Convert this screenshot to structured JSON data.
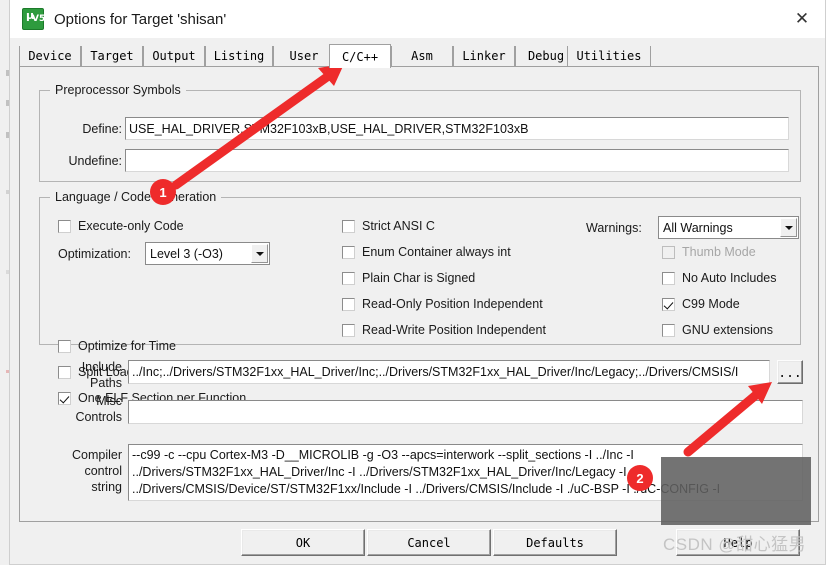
{
  "window": {
    "title": "Options for Target 'shisan'",
    "icon": "keil-uvision5-icon",
    "icon_mu": "µ",
    "icon_v5": "V5",
    "close_label": "✕"
  },
  "tabs": [
    {
      "label": "Device",
      "active": false
    },
    {
      "label": "Target",
      "active": false
    },
    {
      "label": "Output",
      "active": false
    },
    {
      "label": "Listing",
      "active": false
    },
    {
      "label": "User",
      "active": false
    },
    {
      "label": "C/C++",
      "active": true
    },
    {
      "label": "Asm",
      "active": false
    },
    {
      "label": "Linker",
      "active": false
    },
    {
      "label": "Debug",
      "active": false
    },
    {
      "label": "Utilities",
      "active": false
    }
  ],
  "preprocessor": {
    "group_title": "Preprocessor Symbols",
    "define_label": "Define:",
    "define_value": "USE_HAL_DRIVER,STM32F103xB,USE_HAL_DRIVER,STM32F103xB",
    "undefine_label": "Undefine:",
    "undefine_value": ""
  },
  "language": {
    "group_title": "Language / Code Generation",
    "left_options": [
      {
        "label": "Execute-only Code",
        "checked": false,
        "disabled": false
      },
      {
        "label": "Optimize for Time",
        "checked": false,
        "disabled": false
      },
      {
        "label": "Split Load and Store Multiple",
        "checked": false,
        "disabled": false
      },
      {
        "label": "One ELF Section per Function",
        "checked": true,
        "disabled": false
      }
    ],
    "optimization_label": "Optimization:",
    "optimization_value": "Level 3 (-O3)",
    "middle_options": [
      {
        "label": "Strict ANSI C",
        "checked": false,
        "disabled": false
      },
      {
        "label": "Enum Container always int",
        "checked": false,
        "disabled": false
      },
      {
        "label": "Plain Char is Signed",
        "checked": false,
        "disabled": false
      },
      {
        "label": "Read-Only Position Independent",
        "checked": false,
        "disabled": false
      },
      {
        "label": "Read-Write Position Independent",
        "checked": false,
        "disabled": false
      }
    ],
    "warnings_label": "Warnings:",
    "warnings_value": "All Warnings",
    "right_options": [
      {
        "label": "Thumb Mode",
        "checked": false,
        "disabled": true
      },
      {
        "label": "No Auto Includes",
        "checked": false,
        "disabled": false
      },
      {
        "label": "C99 Mode",
        "checked": true,
        "disabled": false
      },
      {
        "label": "GNU extensions",
        "checked": false,
        "disabled": false
      }
    ]
  },
  "paths": {
    "include_label_line1": "Include",
    "include_label_line2": "Paths",
    "include_value": "../Inc;../Drivers/STM32F1xx_HAL_Driver/Inc;../Drivers/STM32F1xx_HAL_Driver/Inc/Legacy;../Drivers/CMSIS/I",
    "browse_label": "...",
    "misc_label_line1": "Misc",
    "misc_label_line2": "Controls",
    "misc_value": ""
  },
  "compiler": {
    "label_line1": "Compiler",
    "label_line2": "control",
    "label_line3": "string",
    "line1": "--c99 -c --cpu Cortex-M3 -D__MICROLIB -g -O3 --apcs=interwork --split_sections -I ../Inc -I",
    "line2": "../Drivers/STM32F1xx_HAL_Driver/Inc -I ../Drivers/STM32F1xx_HAL_Driver/Inc/Legacy -I",
    "line3": "../Drivers/CMSIS/Device/ST/STM32F1xx/Include -I ../Drivers/CMSIS/Include -I ./uC-BSP -I ./uC-CONFIG -I"
  },
  "buttons": [
    {
      "label": "OK"
    },
    {
      "label": "Cancel"
    },
    {
      "label": "Defaults"
    },
    {
      "label": "Help"
    }
  ],
  "annotations": {
    "badge1": "1",
    "badge2": "2",
    "arrow_color": "#ee2b2b"
  },
  "watermark": "CSDN @甜心猛男"
}
